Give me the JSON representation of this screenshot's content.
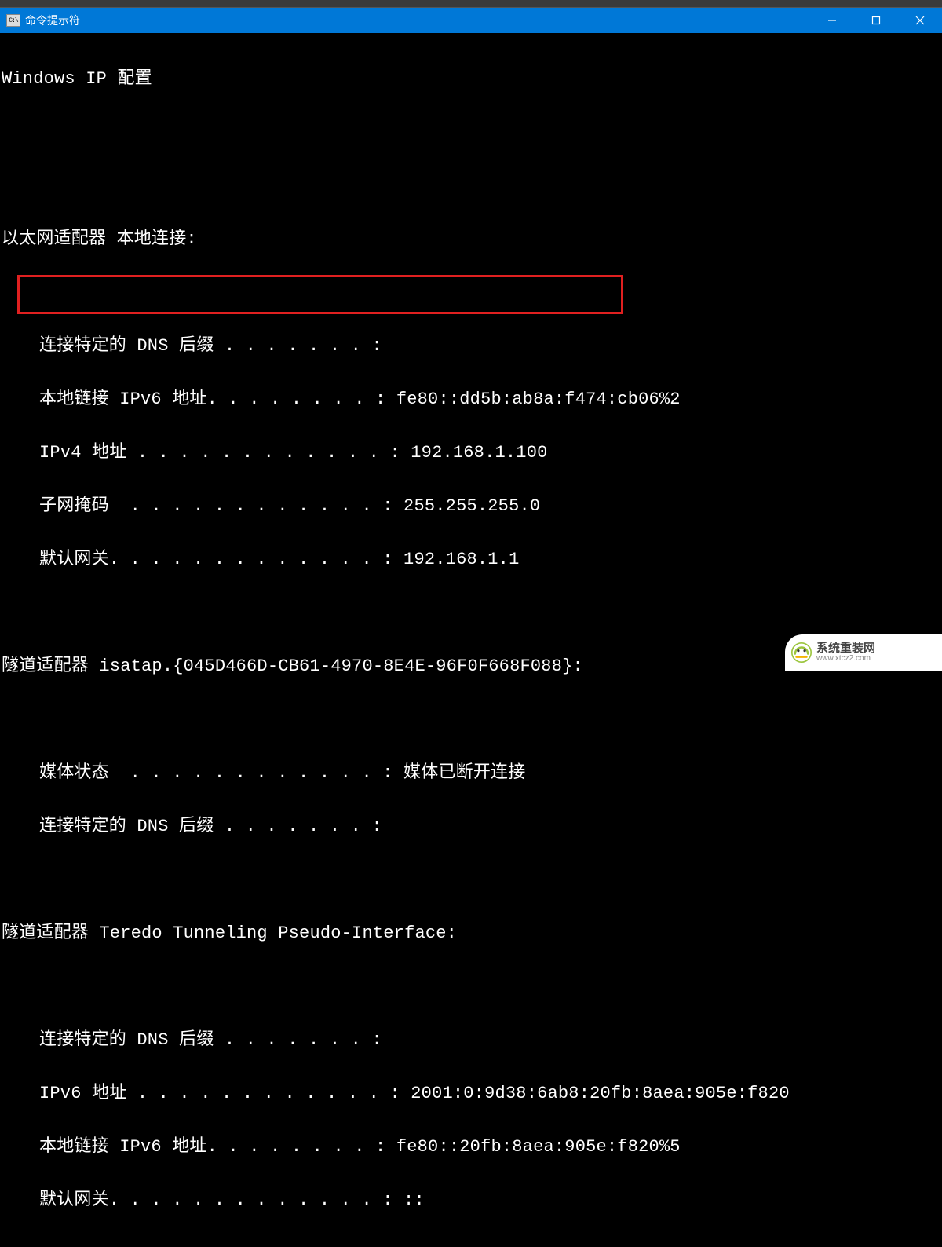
{
  "window": {
    "icon_text": "C:\\",
    "title": "命令提示符"
  },
  "console": {
    "header": "Windows IP 配置",
    "adapter1": {
      "title": "以太网适配器 本地连接:",
      "dns_suffix": "连接特定的 DNS 后缀 . . . . . . . :",
      "ipv6_link": "本地链接 IPv6 地址. . . . . . . . : fe80::dd5b:ab8a:f474:cb06%2",
      "ipv4": "IPv4 地址 . . . . . . . . . . . . : 192.168.1.100",
      "subnet": "子网掩码  . . . . . . . . . . . . : 255.255.255.0",
      "gateway": "默认网关. . . . . . . . . . . . . : 192.168.1.1"
    },
    "adapter2": {
      "title": "隧道适配器 isatap.{045D466D-CB61-4970-8E4E-96F0F668F088}:",
      "media": "媒体状态  . . . . . . . . . . . . : 媒体已断开连接",
      "dns_suffix": "连接特定的 DNS 后缀 . . . . . . . :"
    },
    "adapter3": {
      "title": "隧道适配器 Teredo Tunneling Pseudo-Interface:",
      "dns_suffix": "连接特定的 DNS 后缀 . . . . . . . :",
      "ipv6": "IPv6 地址 . . . . . . . . . . . . : 2001:0:9d38:6ab8:20fb:8aea:905e:f820",
      "ipv6_link": "本地链接 IPv6 地址. . . . . . . . : fe80::20fb:8aea:905e:f820%5",
      "gateway": "默认网关. . . . . . . . . . . . . : ::"
    }
  },
  "watermark": {
    "title": "系统重装网",
    "url": "www.xtcz2.com"
  }
}
